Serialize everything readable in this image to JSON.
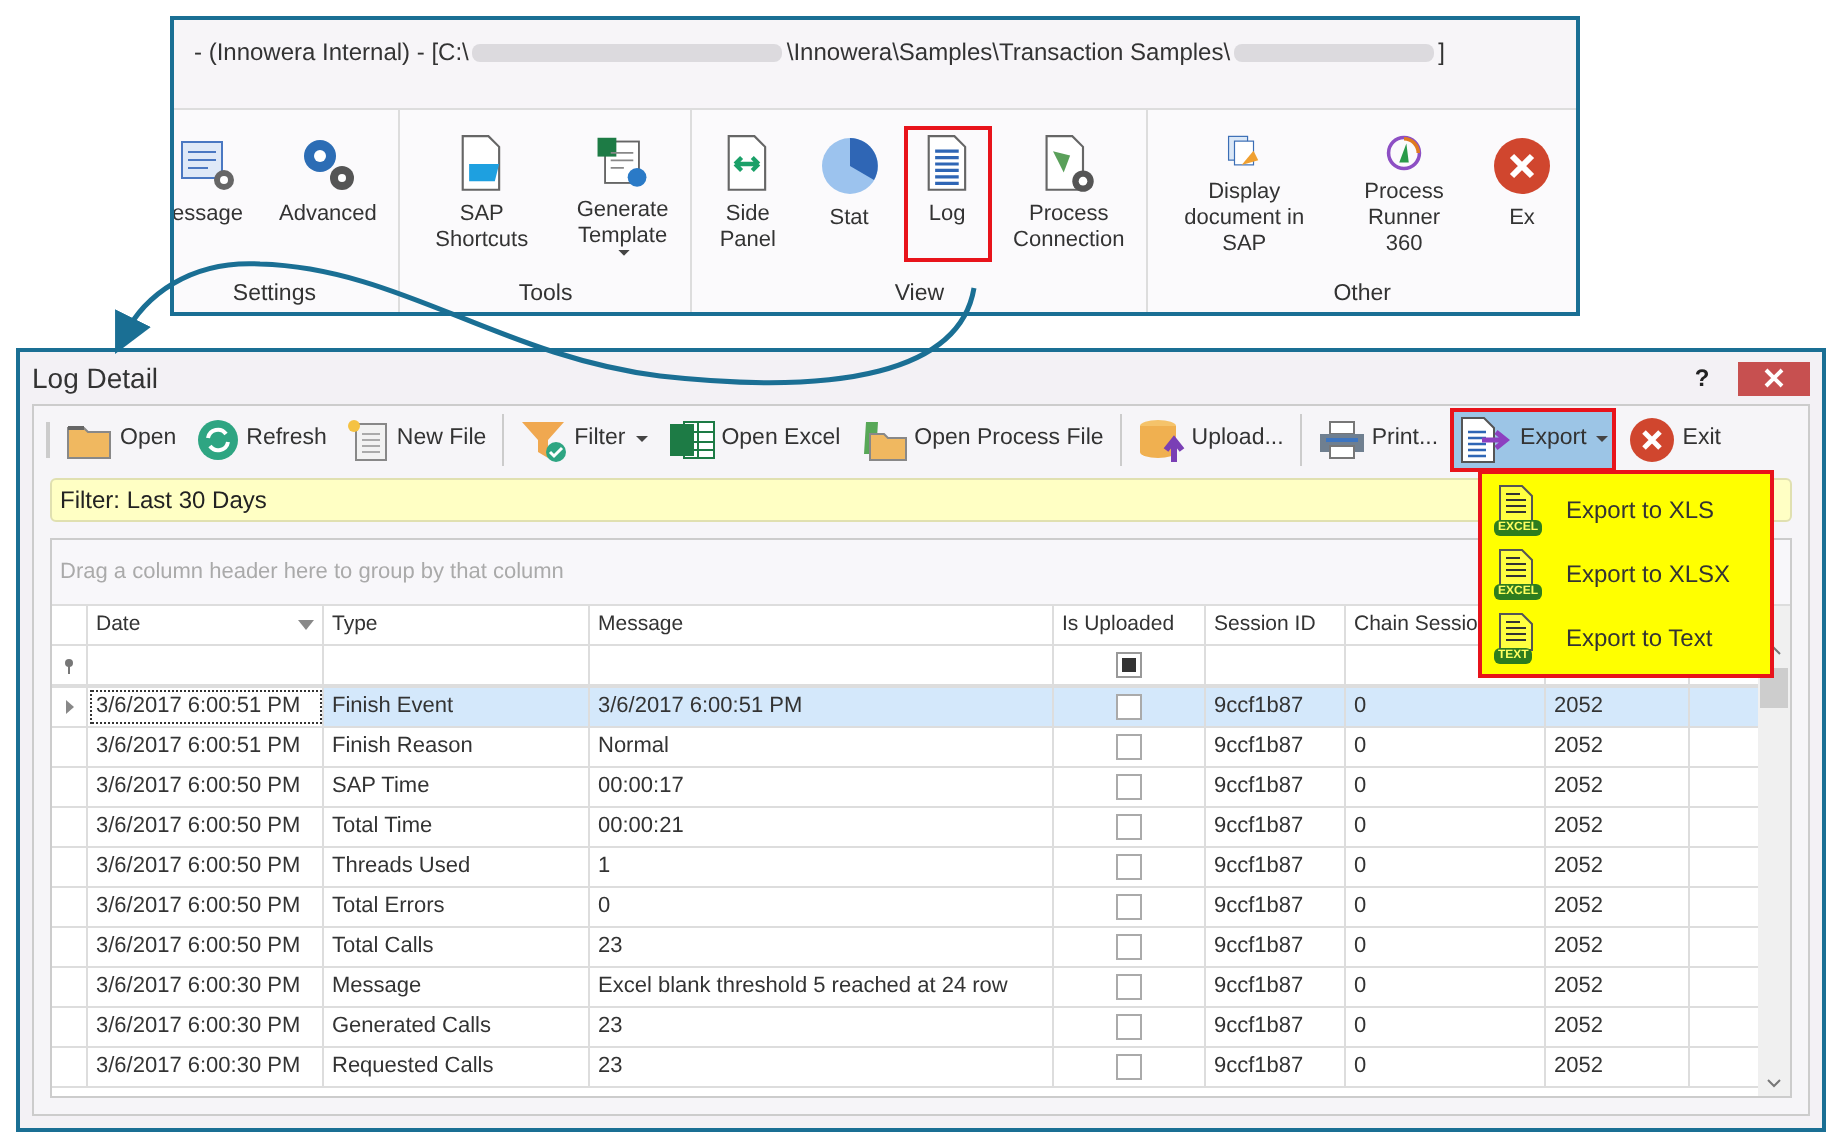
{
  "ribbon": {
    "title": {
      "prefix": "- (Innowera Internal) - [C:\\",
      "middle": "\\Innowera\\Samples\\Transaction Samples\\",
      "suffix": "]"
    },
    "groups": [
      {
        "label": "Settings",
        "items": [
          {
            "label": "essage",
            "kind": "message",
            "dropdown": false,
            "highlighted": false
          },
          {
            "label": "Advanced",
            "kind": "gears",
            "dropdown": false,
            "highlighted": false
          }
        ]
      },
      {
        "label": "Tools",
        "items": [
          {
            "label": "SAP Shortcuts",
            "kind": "shortcuts",
            "dropdown": false,
            "highlighted": false
          },
          {
            "label": "Generate\nTemplate",
            "kind": "template",
            "dropdown": true,
            "highlighted": false
          }
        ]
      },
      {
        "label": "View",
        "items": [
          {
            "label": "Side Panel",
            "kind": "sidepanel",
            "dropdown": false,
            "highlighted": false
          },
          {
            "label": "Stat",
            "kind": "pie",
            "dropdown": false,
            "highlighted": false
          },
          {
            "label": "Log",
            "kind": "log",
            "dropdown": false,
            "highlighted": true
          },
          {
            "label": "Process\nConnection",
            "kind": "connection",
            "dropdown": false,
            "highlighted": false
          }
        ]
      },
      {
        "label": "Other",
        "items": [
          {
            "label": "Display\ndocument in SAP",
            "kind": "display",
            "dropdown": false,
            "highlighted": false
          },
          {
            "label": "Process\nRunner 360",
            "kind": "runner",
            "dropdown": false,
            "highlighted": false
          },
          {
            "label": "Ex",
            "kind": "exit",
            "dropdown": false,
            "highlighted": false
          }
        ]
      }
    ]
  },
  "window": {
    "title": "Log Detail",
    "help": "?"
  },
  "toolbar": [
    {
      "kind": "folder",
      "label": "Open",
      "dropdown": false,
      "highlighted": false
    },
    {
      "kind": "refresh",
      "label": "Refresh",
      "dropdown": false,
      "highlighted": false
    },
    {
      "kind": "newfile",
      "label": "New File",
      "dropdown": false,
      "highlighted": false
    },
    {
      "kind": "separator"
    },
    {
      "kind": "filter",
      "label": "Filter",
      "dropdown": true,
      "highlighted": false
    },
    {
      "kind": "excel",
      "label": "Open Excel",
      "dropdown": false,
      "highlighted": false
    },
    {
      "kind": "processfile",
      "label": "Open Process File",
      "dropdown": false,
      "highlighted": false
    },
    {
      "kind": "separator"
    },
    {
      "kind": "upload",
      "label": "Upload...",
      "dropdown": false,
      "highlighted": false
    },
    {
      "kind": "separator"
    },
    {
      "kind": "print",
      "label": "Print...",
      "dropdown": false,
      "highlighted": false
    },
    {
      "kind": "export",
      "label": "Export",
      "dropdown": true,
      "highlighted": true
    },
    {
      "kind": "exit",
      "label": "Exit",
      "dropdown": false,
      "highlighted": false
    }
  ],
  "export_menu": [
    {
      "label": "Export to XLS",
      "badge": "EXCEL"
    },
    {
      "label": "Export to XLSX",
      "badge": "EXCEL"
    },
    {
      "label": "Export to Text",
      "badge": "TEXT"
    }
  ],
  "filter_bar": "Filter: Last 30 Days",
  "group_panel": "Drag a column header here to group by that column",
  "grid": {
    "columns": [
      {
        "label": "Date",
        "sorted": true
      },
      {
        "label": "Type"
      },
      {
        "label": "Message"
      },
      {
        "label": "Is Uploaded"
      },
      {
        "label": "Session ID"
      },
      {
        "label": "Chain Sessio"
      }
    ],
    "filter_row": {
      "is_uploaded_indeterminate": true
    },
    "rows": [
      {
        "date": "3/6/2017 6:00:51 PM",
        "type": "Finish Event",
        "message": "3/6/2017 6:00:51 PM",
        "is_uploaded": false,
        "session_id": "9ccf1b87",
        "chain_session": "0",
        "column_7": "2052",
        "selected": true
      },
      {
        "date": "3/6/2017 6:00:51 PM",
        "type": "Finish Reason",
        "message": "Normal",
        "is_uploaded": false,
        "session_id": "9ccf1b87",
        "chain_session": "0",
        "column_7": "2052",
        "selected": false
      },
      {
        "date": "3/6/2017 6:00:50 PM",
        "type": "SAP Time",
        "message": "00:00:17",
        "is_uploaded": false,
        "session_id": "9ccf1b87",
        "chain_session": "0",
        "column_7": "2052",
        "selected": false
      },
      {
        "date": "3/6/2017 6:00:50 PM",
        "type": "Total Time",
        "message": "00:00:21",
        "is_uploaded": false,
        "session_id": "9ccf1b87",
        "chain_session": "0",
        "column_7": "2052",
        "selected": false
      },
      {
        "date": "3/6/2017 6:00:50 PM",
        "type": "Threads Used",
        "message": "1",
        "is_uploaded": false,
        "session_id": "9ccf1b87",
        "chain_session": "0",
        "column_7": "2052",
        "selected": false
      },
      {
        "date": "3/6/2017 6:00:50 PM",
        "type": "Total Errors",
        "message": "0",
        "is_uploaded": false,
        "session_id": "9ccf1b87",
        "chain_session": "0",
        "column_7": "2052",
        "selected": false
      },
      {
        "date": "3/6/2017 6:00:50 PM",
        "type": "Total Calls",
        "message": "23",
        "is_uploaded": false,
        "session_id": "9ccf1b87",
        "chain_session": "0",
        "column_7": "2052",
        "selected": false
      },
      {
        "date": "3/6/2017 6:00:30 PM",
        "type": "Message",
        "message": "Excel blank threshold 5 reached at 24 row",
        "is_uploaded": false,
        "session_id": "9ccf1b87",
        "chain_session": "0",
        "column_7": "2052",
        "selected": false
      },
      {
        "date": "3/6/2017 6:00:30 PM",
        "type": "Generated Calls",
        "message": "23",
        "is_uploaded": false,
        "session_id": "9ccf1b87",
        "chain_session": "0",
        "column_7": "2052",
        "selected": false
      },
      {
        "date": "3/6/2017 6:00:30 PM",
        "type": "Requested Calls",
        "message": "23",
        "is_uploaded": false,
        "session_id": "9ccf1b87",
        "chain_session": "0",
        "column_7": "2052",
        "selected": false
      }
    ]
  }
}
